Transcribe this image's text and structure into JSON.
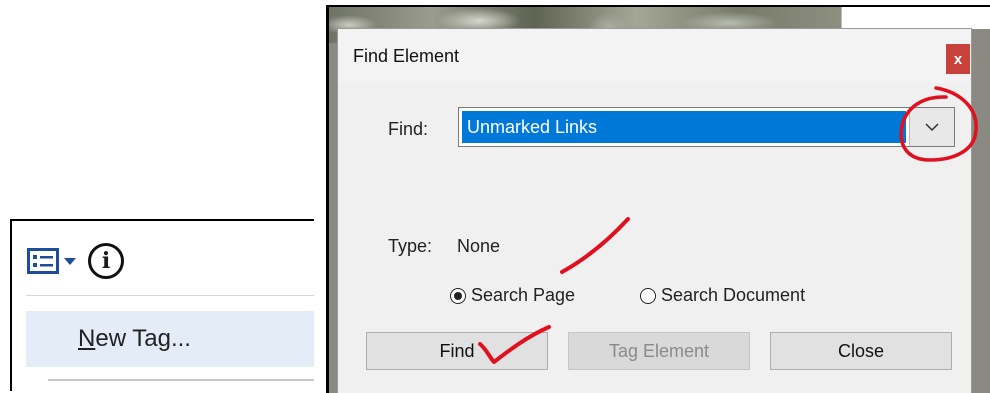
{
  "left_panel": {
    "options_icon": "tag-options-icon",
    "info_icon": "info-icon",
    "info_glyph": "i",
    "menu_item": {
      "mnemonic": "N",
      "rest": "ew Tag..."
    }
  },
  "dialog": {
    "title": "Find Element",
    "close_glyph": "x",
    "find_label": "Find:",
    "find_value": "Unmarked Links",
    "type_label": "Type:",
    "type_value": "None",
    "radios": {
      "search_page": {
        "label": "Search Page",
        "selected": true
      },
      "search_document": {
        "label": "Search Document",
        "selected": false
      }
    },
    "buttons": {
      "find": "Find",
      "tag_element": "Tag Element",
      "close": "Close"
    }
  },
  "colors": {
    "accent": "#0078d7",
    "close_button": "#c9413b",
    "annotation_ink": "#e0101e",
    "menu_highlight": "#e3ecf7"
  }
}
